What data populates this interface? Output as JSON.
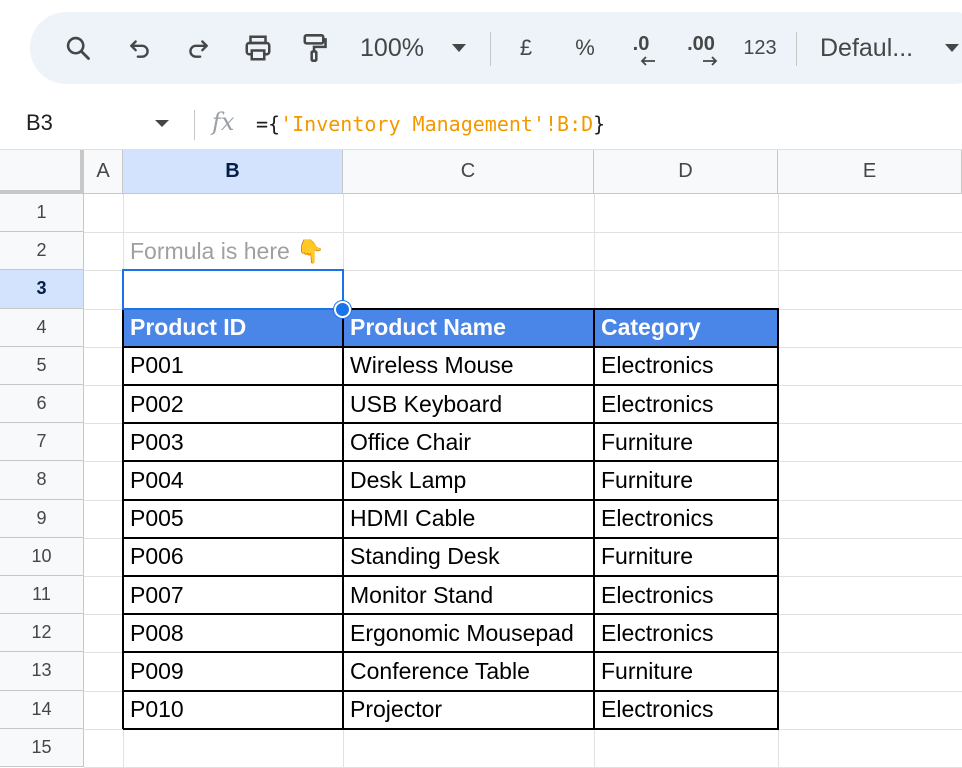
{
  "toolbar": {
    "zoom": "100%",
    "currency": "£",
    "percent": "%",
    "decrease_decimal": ".0",
    "increase_decimal": ".00",
    "number_format": "123",
    "font": "Defaul...",
    "icons": [
      "search-icon",
      "undo-icon",
      "redo-icon",
      "print-icon",
      "paint-format-icon"
    ]
  },
  "formula_bar": {
    "cell_ref": "B3",
    "fx": "fx",
    "formula_prefix": "={",
    "formula_string": "'Inventory Management'!B:D",
    "formula_suffix": "}"
  },
  "grid": {
    "columns": [
      "A",
      "B",
      "C",
      "D",
      "E"
    ],
    "rows": [
      "1",
      "2",
      "3",
      "4",
      "5",
      "6",
      "7",
      "8",
      "9",
      "10",
      "11",
      "12",
      "13",
      "14",
      "15"
    ],
    "selected_column": "B",
    "selected_row": "3",
    "note": "Formula is here 👇",
    "table_headers": [
      "Product ID",
      "Product Name",
      "Category"
    ],
    "table_rows": [
      [
        "P001",
        "Wireless Mouse",
        "Electronics"
      ],
      [
        "P002",
        "USB Keyboard",
        "Electronics"
      ],
      [
        "P003",
        "Office Chair",
        "Furniture"
      ],
      [
        "P004",
        "Desk Lamp",
        "Furniture"
      ],
      [
        "P005",
        "HDMI Cable",
        "Electronics"
      ],
      [
        "P006",
        "Standing Desk",
        "Furniture"
      ],
      [
        "P007",
        "Monitor Stand",
        "Electronics"
      ],
      [
        "P008",
        "Ergonomic Mousepad",
        "Electronics"
      ],
      [
        "P009",
        "Conference Table",
        "Furniture"
      ],
      [
        "P010",
        "Projector",
        "Electronics"
      ]
    ]
  },
  "colors": {
    "header_fill": "#4a86e8",
    "selection": "#1a73e8",
    "header_selected": "#d3e3fd",
    "formula_string": "#f29900"
  }
}
